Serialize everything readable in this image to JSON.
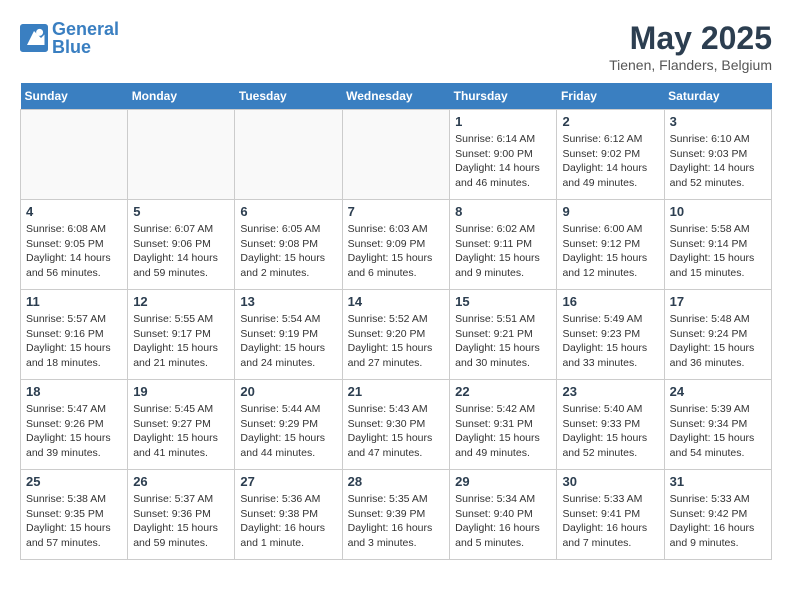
{
  "header": {
    "logo_general": "General",
    "logo_blue": "Blue",
    "month_year": "May 2025",
    "location": "Tienen, Flanders, Belgium"
  },
  "days_of_week": [
    "Sunday",
    "Monday",
    "Tuesday",
    "Wednesday",
    "Thursday",
    "Friday",
    "Saturday"
  ],
  "weeks": [
    [
      {
        "day": "",
        "info": ""
      },
      {
        "day": "",
        "info": ""
      },
      {
        "day": "",
        "info": ""
      },
      {
        "day": "",
        "info": ""
      },
      {
        "day": "1",
        "info": "Sunrise: 6:14 AM\nSunset: 9:00 PM\nDaylight: 14 hours\nand 46 minutes."
      },
      {
        "day": "2",
        "info": "Sunrise: 6:12 AM\nSunset: 9:02 PM\nDaylight: 14 hours\nand 49 minutes."
      },
      {
        "day": "3",
        "info": "Sunrise: 6:10 AM\nSunset: 9:03 PM\nDaylight: 14 hours\nand 52 minutes."
      }
    ],
    [
      {
        "day": "4",
        "info": "Sunrise: 6:08 AM\nSunset: 9:05 PM\nDaylight: 14 hours\nand 56 minutes."
      },
      {
        "day": "5",
        "info": "Sunrise: 6:07 AM\nSunset: 9:06 PM\nDaylight: 14 hours\nand 59 minutes."
      },
      {
        "day": "6",
        "info": "Sunrise: 6:05 AM\nSunset: 9:08 PM\nDaylight: 15 hours\nand 2 minutes."
      },
      {
        "day": "7",
        "info": "Sunrise: 6:03 AM\nSunset: 9:09 PM\nDaylight: 15 hours\nand 6 minutes."
      },
      {
        "day": "8",
        "info": "Sunrise: 6:02 AM\nSunset: 9:11 PM\nDaylight: 15 hours\nand 9 minutes."
      },
      {
        "day": "9",
        "info": "Sunrise: 6:00 AM\nSunset: 9:12 PM\nDaylight: 15 hours\nand 12 minutes."
      },
      {
        "day": "10",
        "info": "Sunrise: 5:58 AM\nSunset: 9:14 PM\nDaylight: 15 hours\nand 15 minutes."
      }
    ],
    [
      {
        "day": "11",
        "info": "Sunrise: 5:57 AM\nSunset: 9:16 PM\nDaylight: 15 hours\nand 18 minutes."
      },
      {
        "day": "12",
        "info": "Sunrise: 5:55 AM\nSunset: 9:17 PM\nDaylight: 15 hours\nand 21 minutes."
      },
      {
        "day": "13",
        "info": "Sunrise: 5:54 AM\nSunset: 9:19 PM\nDaylight: 15 hours\nand 24 minutes."
      },
      {
        "day": "14",
        "info": "Sunrise: 5:52 AM\nSunset: 9:20 PM\nDaylight: 15 hours\nand 27 minutes."
      },
      {
        "day": "15",
        "info": "Sunrise: 5:51 AM\nSunset: 9:21 PM\nDaylight: 15 hours\nand 30 minutes."
      },
      {
        "day": "16",
        "info": "Sunrise: 5:49 AM\nSunset: 9:23 PM\nDaylight: 15 hours\nand 33 minutes."
      },
      {
        "day": "17",
        "info": "Sunrise: 5:48 AM\nSunset: 9:24 PM\nDaylight: 15 hours\nand 36 minutes."
      }
    ],
    [
      {
        "day": "18",
        "info": "Sunrise: 5:47 AM\nSunset: 9:26 PM\nDaylight: 15 hours\nand 39 minutes."
      },
      {
        "day": "19",
        "info": "Sunrise: 5:45 AM\nSunset: 9:27 PM\nDaylight: 15 hours\nand 41 minutes."
      },
      {
        "day": "20",
        "info": "Sunrise: 5:44 AM\nSunset: 9:29 PM\nDaylight: 15 hours\nand 44 minutes."
      },
      {
        "day": "21",
        "info": "Sunrise: 5:43 AM\nSunset: 9:30 PM\nDaylight: 15 hours\nand 47 minutes."
      },
      {
        "day": "22",
        "info": "Sunrise: 5:42 AM\nSunset: 9:31 PM\nDaylight: 15 hours\nand 49 minutes."
      },
      {
        "day": "23",
        "info": "Sunrise: 5:40 AM\nSunset: 9:33 PM\nDaylight: 15 hours\nand 52 minutes."
      },
      {
        "day": "24",
        "info": "Sunrise: 5:39 AM\nSunset: 9:34 PM\nDaylight: 15 hours\nand 54 minutes."
      }
    ],
    [
      {
        "day": "25",
        "info": "Sunrise: 5:38 AM\nSunset: 9:35 PM\nDaylight: 15 hours\nand 57 minutes."
      },
      {
        "day": "26",
        "info": "Sunrise: 5:37 AM\nSunset: 9:36 PM\nDaylight: 15 hours\nand 59 minutes."
      },
      {
        "day": "27",
        "info": "Sunrise: 5:36 AM\nSunset: 9:38 PM\nDaylight: 16 hours\nand 1 minute."
      },
      {
        "day": "28",
        "info": "Sunrise: 5:35 AM\nSunset: 9:39 PM\nDaylight: 16 hours\nand 3 minutes."
      },
      {
        "day": "29",
        "info": "Sunrise: 5:34 AM\nSunset: 9:40 PM\nDaylight: 16 hours\nand 5 minutes."
      },
      {
        "day": "30",
        "info": "Sunrise: 5:33 AM\nSunset: 9:41 PM\nDaylight: 16 hours\nand 7 minutes."
      },
      {
        "day": "31",
        "info": "Sunrise: 5:33 AM\nSunset: 9:42 PM\nDaylight: 16 hours\nand 9 minutes."
      }
    ]
  ]
}
